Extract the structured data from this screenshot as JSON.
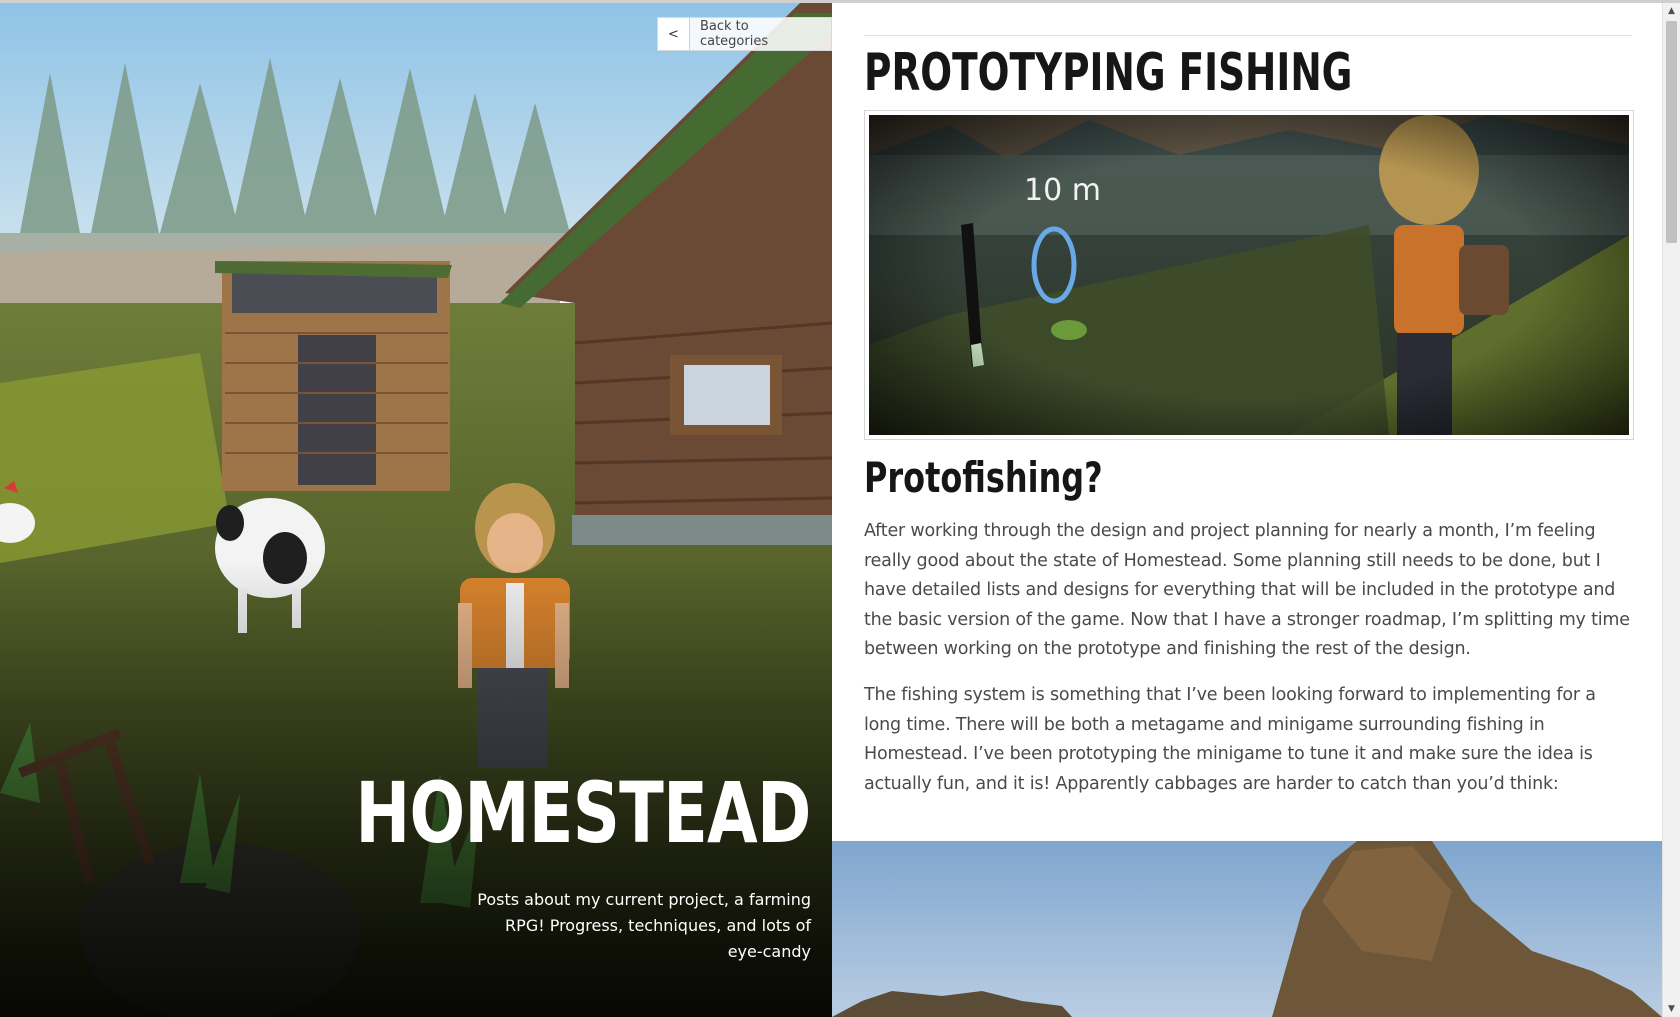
{
  "hero": {
    "back_label": "Back to categories",
    "back_chevron": "<",
    "title": "HOMESTEAD",
    "description": "Posts about my current project, a farming RPG! Progress, techniques, and lots of eye-candy"
  },
  "article": {
    "title": "PROTOTYPING FISHING",
    "figure1": {
      "distance_label": "10 m"
    },
    "section_heading": "Protofishing?",
    "paragraphs": [
      "After working through the design and project planning for nearly a month, I’m feeling really good about the state of Homestead. Some planning still needs to be done, but I have detailed lists and designs for everything that will be included in the prototype and the basic version of the game. Now that I have a stronger roadmap, I’m splitting my time between working on the prototype and finishing the rest of the design.",
      "The fishing system is something that I’ve been looking forward to implementing for a long time. There will be both a metagame and minigame surrounding fishing in Homestead. I’ve been prototyping the minigame to tune it and make sure the idea is actually fun, and it is! Apparently cabbages are harder to catch than you’d think:"
    ]
  },
  "scrollbar": {
    "up_icon": "▲",
    "down_icon": "▼"
  }
}
